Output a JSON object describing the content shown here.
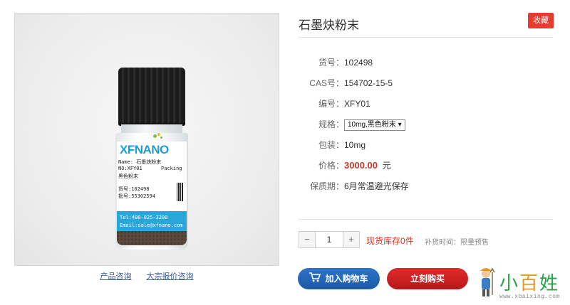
{
  "product": {
    "title": "石墨炔粉末",
    "favorite_label": "收藏",
    "specs": [
      {
        "key": "货号",
        "value": "102498"
      },
      {
        "key": "CAS号",
        "value": "154702-15-5"
      },
      {
        "key": "编号",
        "value": "XFY01"
      },
      {
        "key": "规格",
        "value": "10mg,黑色粉末"
      },
      {
        "key": "包装",
        "value": "10mg"
      },
      {
        "key": "价格",
        "value": "3000.00",
        "unit": "元"
      },
      {
        "key": "保质期",
        "value": "6月常温避光保存"
      }
    ],
    "separator": "："
  },
  "image_links": {
    "consult": "产品咨询",
    "bulk_quote": "大宗报价咨询"
  },
  "vial_label": {
    "brand": "XFNANO",
    "name_line": "Name: 石墨炔粉末",
    "no_line": "NO:XFY01",
    "packing": "Packing",
    "form_line": "黑色粉末",
    "item_line": "货号:102498",
    "batch_line": "批号:55302594",
    "tel_line": "Tel:400-025-3200",
    "email_line": "Email:sale@xfnano.com"
  },
  "purchase": {
    "minus": "−",
    "plus": "+",
    "quantity": "1",
    "stock_status": "现货库存0件",
    "restock_text": "补货时间：限量预售",
    "add_to_cart": "加入购物车",
    "buy_now": "立刻购买"
  },
  "watermark": {
    "text_1": "小",
    "text_2": "百",
    "text_3": "姓",
    "url": "www.xbaixing.com"
  },
  "colors": {
    "accent_red": "#e63b2e",
    "price_red": "#c0392b",
    "cart_blue": "#1c59a8",
    "buy_red": "#c11f1f"
  }
}
